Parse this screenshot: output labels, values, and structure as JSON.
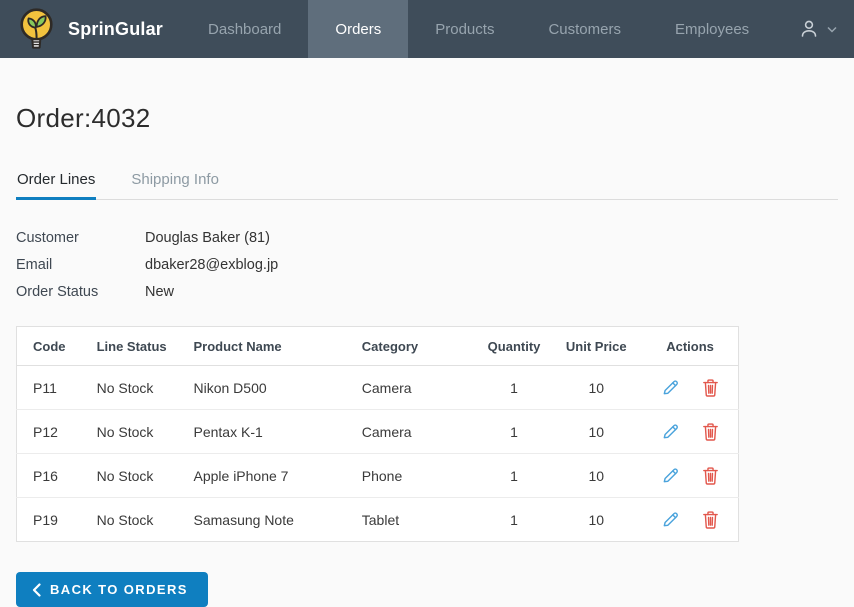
{
  "brand": {
    "name": "SprinGular",
    "logo_icon": "lightbulb-leaf-icon"
  },
  "nav": {
    "items": [
      {
        "label": "Dashboard",
        "active": false
      },
      {
        "label": "Orders",
        "active": true
      },
      {
        "label": "Products",
        "active": false
      },
      {
        "label": "Customers",
        "active": false
      },
      {
        "label": "Employees",
        "active": false
      }
    ],
    "account_icon": "user-icon",
    "account_chevron_icon": "chevron-down-icon"
  },
  "page": {
    "title": "Order:4032"
  },
  "tabs": [
    {
      "label": "Order Lines",
      "active": true
    },
    {
      "label": "Shipping Info",
      "active": false
    }
  ],
  "details": [
    {
      "label": "Customer",
      "value": "Douglas Baker (81)"
    },
    {
      "label": "Email",
      "value": "dbaker28@exblog.jp"
    },
    {
      "label": "Order Status",
      "value": "New"
    }
  ],
  "table": {
    "headers": [
      "Code",
      "Line Status",
      "Product Name",
      "Category",
      "Quantity",
      "Unit Price",
      "Actions"
    ],
    "rows": [
      {
        "code": "P11",
        "line_status": "No Stock",
        "product_name": "Nikon D500",
        "category": "Camera",
        "quantity": "1",
        "unit_price": "10"
      },
      {
        "code": "P12",
        "line_status": "No Stock",
        "product_name": "Pentax K-1",
        "category": "Camera",
        "quantity": "1",
        "unit_price": "10"
      },
      {
        "code": "P16",
        "line_status": "No Stock",
        "product_name": "Apple iPhone 7",
        "category": "Phone",
        "quantity": "1",
        "unit_price": "10"
      },
      {
        "code": "P19",
        "line_status": "No Stock",
        "product_name": "Samasung Note",
        "category": "Tablet",
        "quantity": "1",
        "unit_price": "10"
      }
    ],
    "action_icons": [
      "edit-pencil-icon",
      "delete-trash-icon"
    ]
  },
  "footer": {
    "back_button_label": "BACK TO ORDERS"
  },
  "colors": {
    "navbar_bg": "#3f4d5a",
    "nav_active_bg": "#5f6e7c",
    "accent_blue": "#0f7fc0",
    "pencil_blue": "#4aa3dc",
    "trash_red": "#e2574c"
  }
}
